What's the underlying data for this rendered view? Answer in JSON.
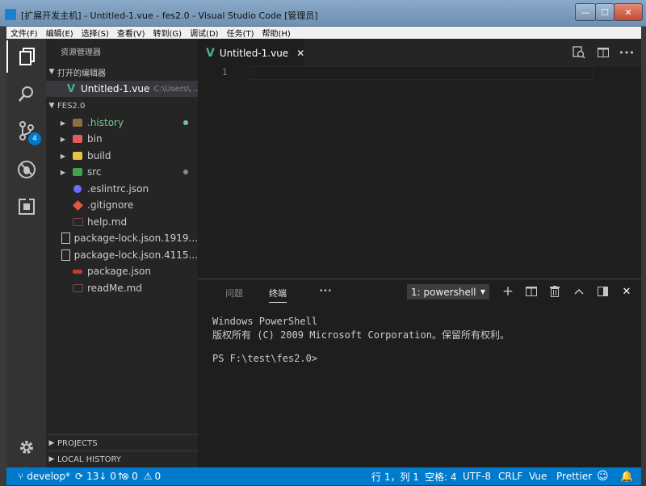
{
  "window": {
    "title": "[扩展开发主机] - Untitled-1.vue - fes2.0 - Visual Studio Code [管理员]",
    "minimize": "—",
    "maximize": "☐",
    "close": "✕"
  },
  "menu": [
    "文件(F)",
    "编辑(E)",
    "选择(S)",
    "查看(V)",
    "转到(G)",
    "调试(D)",
    "任务(T)",
    "帮助(H)"
  ],
  "activity": {
    "scm_badge": "4"
  },
  "sidebar": {
    "title": "资源管理器",
    "open_editors_label": "打开的编辑器",
    "open_editor": {
      "name": "Untitled-1.vue",
      "path": "C:\\Users\\..."
    },
    "folder_label": "FES2.0",
    "tree": [
      {
        "name": ".history",
        "kind": "folder"
      },
      {
        "name": "bin",
        "kind": "folder"
      },
      {
        "name": "build",
        "kind": "folder"
      },
      {
        "name": "src",
        "kind": "folder"
      },
      {
        "name": ".eslintrc.json",
        "kind": "file"
      },
      {
        "name": ".gitignore",
        "kind": "file"
      },
      {
        "name": "help.md",
        "kind": "file"
      },
      {
        "name": "package-lock.json.1919...",
        "kind": "file"
      },
      {
        "name": "package-lock.json.4115...",
        "kind": "file"
      },
      {
        "name": "package.json",
        "kind": "file"
      },
      {
        "name": "readMe.md",
        "kind": "file"
      }
    ],
    "projects_label": "PROJECTS",
    "history_label": "LOCAL HISTORY"
  },
  "editor": {
    "tab_label": "Untitled-1.vue",
    "line_number": "1"
  },
  "panel": {
    "tab_problems": "问题",
    "tab_terminal": "终端",
    "more": "•••",
    "terminal_select": "1: powershell",
    "terminal_lines": [
      "Windows PowerShell",
      "版权所有 (C) 2009 Microsoft Corporation。保留所有权利。",
      "",
      "PS F:\\test\\fes2.0>"
    ]
  },
  "statusbar": {
    "branch": "develop*",
    "sync": "13↓ 0↑",
    "errors": "0",
    "warnings": "0",
    "position": "行 1，列 1",
    "spaces": "空格: 4",
    "encoding": "UTF-8",
    "eol": "CRLF",
    "language": "Vue",
    "formatter": "Prettier"
  },
  "colors": {
    "accent": "#007acc",
    "vue_green": "#41b883",
    "git_added": "#73c991",
    "git_modified": "#8a8a8a"
  }
}
